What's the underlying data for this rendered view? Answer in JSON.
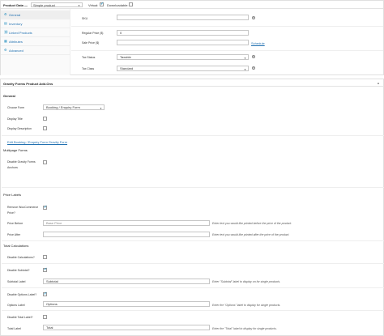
{
  "product_data": {
    "title": "Product Data —",
    "type_select": "Simple product",
    "virtual_label": "Virtual:",
    "virtual_checked": true,
    "downloadable_label": "Downloadable:",
    "downloadable_checked": false,
    "tabs": [
      {
        "label": "General",
        "icon": "gear-icon",
        "glyph": "⚙",
        "active": true
      },
      {
        "label": "Inventory",
        "icon": "inventory-icon",
        "glyph": "▤",
        "active": false
      },
      {
        "label": "Linked Products",
        "icon": "link-icon",
        "glyph": "⛓",
        "active": false
      },
      {
        "label": "Attributes",
        "icon": "attributes-icon",
        "glyph": "▦",
        "active": false
      },
      {
        "label": "Advanced",
        "icon": "advanced-gear-icon",
        "glyph": "⚙",
        "active": false
      }
    ],
    "fields": {
      "sku_label": "SKU",
      "sku_value": "",
      "regular_price_label": "Regular Price ($)",
      "regular_price_value": "0",
      "sale_price_label": "Sale Price ($)",
      "sale_price_value": "",
      "schedule_link": "Schedule",
      "tax_status_label": "Tax Status",
      "tax_status_value": "Taxable",
      "tax_class_label": "Tax Class",
      "tax_class_value": "Standard"
    }
  },
  "gravity_forms": {
    "title": "Gravity Forms Product Add-Ons",
    "general_title": "General",
    "choose_form_label": "Choose Form",
    "choose_form_value": "Booking / Enquiry Form",
    "display_title_label": "Display Title",
    "display_title_checked": false,
    "display_description_label": "Display Description",
    "display_description_checked": false,
    "edit_link": "Edit Booking / Enquiry Form Gravity Form",
    "multipage_title": "Multipage Forms",
    "disable_anchors_label_1": "Disable Gravity Forms",
    "disable_anchors_label_2": "Anchors",
    "disable_anchors_checked": false,
    "price_labels_title": "Price Labels",
    "remove_price_label_1": "Remove WooCommerce",
    "remove_price_label_2": "Price?",
    "remove_price_checked": true,
    "price_before_label": "Price Before",
    "price_before_placeholder": "Base Price",
    "price_before_hint": "Enter text you would like printed before the price of the product.",
    "price_after_label": "Price After",
    "price_after_value": "",
    "price_after_hint": "Enter text you would like printed after the price of the product.",
    "total_calc_title": "Total Calculations",
    "disable_calcs_label": "Disable Calculations?",
    "disable_calcs_checked": false,
    "disable_subtotal_label": "Disable Subtotal?",
    "disable_subtotal_checked": true,
    "subtotal_label_label": "Subtotal Label",
    "subtotal_label_value": "Subtotal",
    "subtotal_hint": "Enter \"Subtotal\" label to display on for single products.",
    "disable_options_label": "Disable Options Label?",
    "disable_options_checked": true,
    "options_label_label": "Options Label",
    "options_label_value": "Options",
    "options_hint": "Enter the \"Options\" label to display for single products.",
    "disable_total_label": "Disable Total Label?",
    "disable_total_checked": false,
    "total_label_label": "Total Label",
    "total_label_value": "Total",
    "total_hint": "Enter the \"Total\" label to display for single products."
  }
}
